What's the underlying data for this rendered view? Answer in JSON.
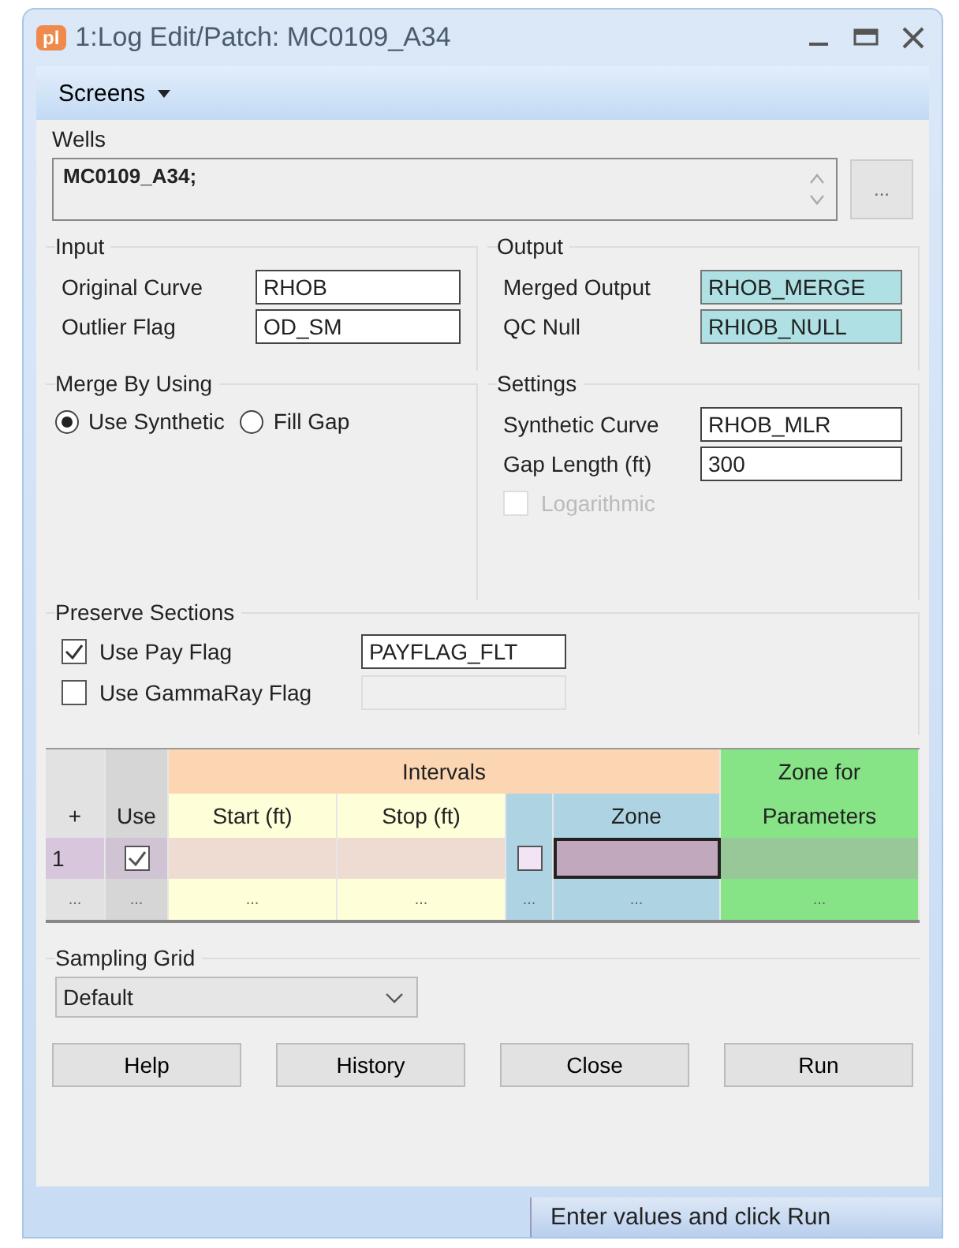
{
  "window": {
    "title": "1:Log Edit/Patch: MC0109_A34",
    "logo": "pl"
  },
  "menu": {
    "label": "Screens"
  },
  "wells": {
    "label": "Wells",
    "value": "MC0109_A34;",
    "button": "..."
  },
  "input": {
    "label": "Input",
    "fields": [
      {
        "label": "Original Curve",
        "value": "RHOB"
      },
      {
        "label": "Outlier Flag",
        "value": "OD_SM"
      }
    ]
  },
  "output": {
    "label": "Output",
    "fields": [
      {
        "label": "Merged Output",
        "value": "RHOB_MERGE"
      },
      {
        "label": "QC Null",
        "value": "RHIOB_NULL"
      }
    ]
  },
  "merge": {
    "label": "Merge By Using",
    "options": [
      {
        "label": "Use Synthetic",
        "selected": true
      },
      {
        "label": "Fill Gap",
        "selected": false
      }
    ]
  },
  "settings": {
    "label": "Settings",
    "fields": [
      {
        "label": "Synthetic Curve",
        "value": "RHOB_MLR"
      },
      {
        "label": "Gap Length (ft)",
        "value": "300"
      }
    ],
    "logarithmic": {
      "label": "Logarithmic",
      "checked": false,
      "disabled": true
    }
  },
  "preserve": {
    "label": "Preserve Sections",
    "rows": [
      {
        "label": "Use Pay Flag",
        "checked": true,
        "value": "PAYFLAG_FLT"
      },
      {
        "label": "Use GammaRay Flag",
        "checked": false
      }
    ]
  },
  "grid": {
    "group_headers": [
      "Intervals",
      "Zone for"
    ],
    "add": "+",
    "columns": [
      "Use",
      "Start (ft)",
      "Stop (ft)",
      "Zone",
      "Parameters"
    ],
    "rows": [
      {
        "number": "1",
        "use": true,
        "zone_flag": false
      }
    ],
    "new_row": [
      "...",
      "...",
      "...",
      "...",
      "...",
      "...",
      "..."
    ]
  },
  "sampling": {
    "label": "Sampling Grid",
    "value": "Default"
  },
  "buttons": [
    "Help",
    "History",
    "Close",
    "Run"
  ],
  "status_bar": "Enter values and click Run"
}
